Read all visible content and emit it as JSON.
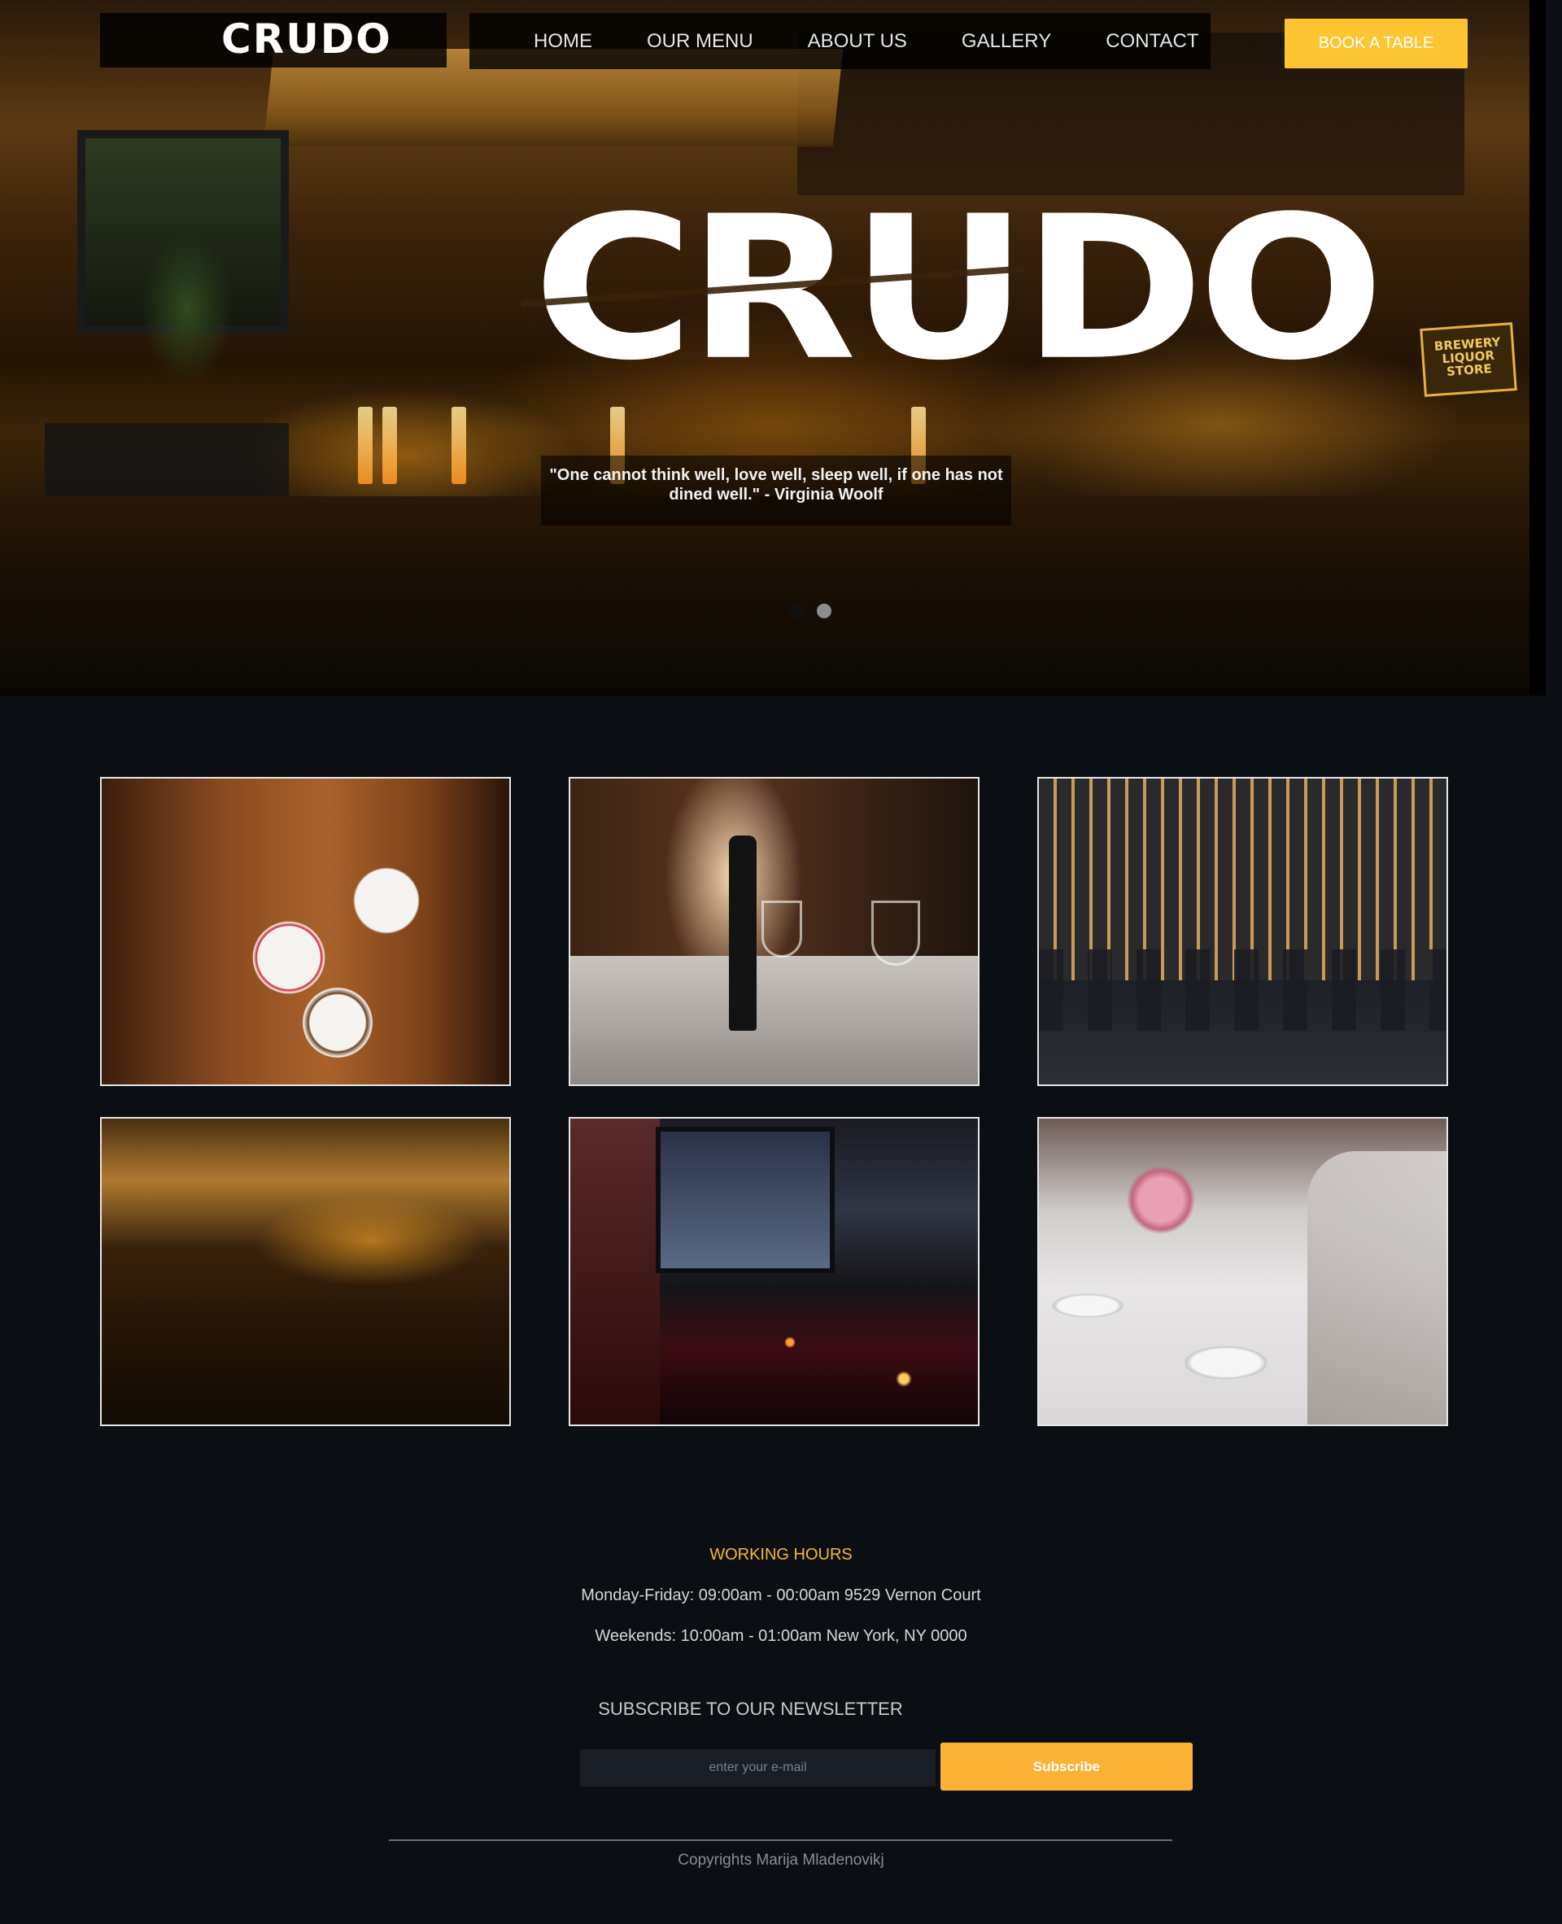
{
  "brand": {
    "name": "CRUDO",
    "hero_title": "CRUDO"
  },
  "nav": {
    "items": [
      "HOME",
      "OUR MENU",
      "ABOUT US",
      "GALLERY",
      "CONTACT"
    ],
    "book_label": "BOOK A TABLE"
  },
  "hero": {
    "quote": "\"One cannot think well, love well, sleep well, if one has not dined well.\" - Virginia Woolf",
    "store_sign": "BREWERY LIQUOR STORE",
    "slides": {
      "count": 2,
      "active": 1
    }
  },
  "gallery": {
    "photos": [
      "food-table-photo",
      "wine-bottle-photo",
      "dining-room-photo",
      "bar-interior-photo",
      "red-restaurant-photo",
      "table-setting-photo"
    ]
  },
  "hours": {
    "title": "WORKING HOURS",
    "line1": "Monday-Friday: 09:00am - 00:00am 9529 Vernon Court",
    "line2": "Weekends: 10:00am - 01:00am New York, NY 0000"
  },
  "newsletter": {
    "title": "SUBSCRIBE TO OUR NEWSLETTER",
    "placeholder": "enter your e-mail",
    "button": "Subscribe"
  },
  "footer": {
    "copyright": "Copyrights Marija Mladenovikj"
  },
  "colors": {
    "accent": "#fcc531",
    "background": "#0b0e13",
    "hours_title": "#f5b830"
  }
}
